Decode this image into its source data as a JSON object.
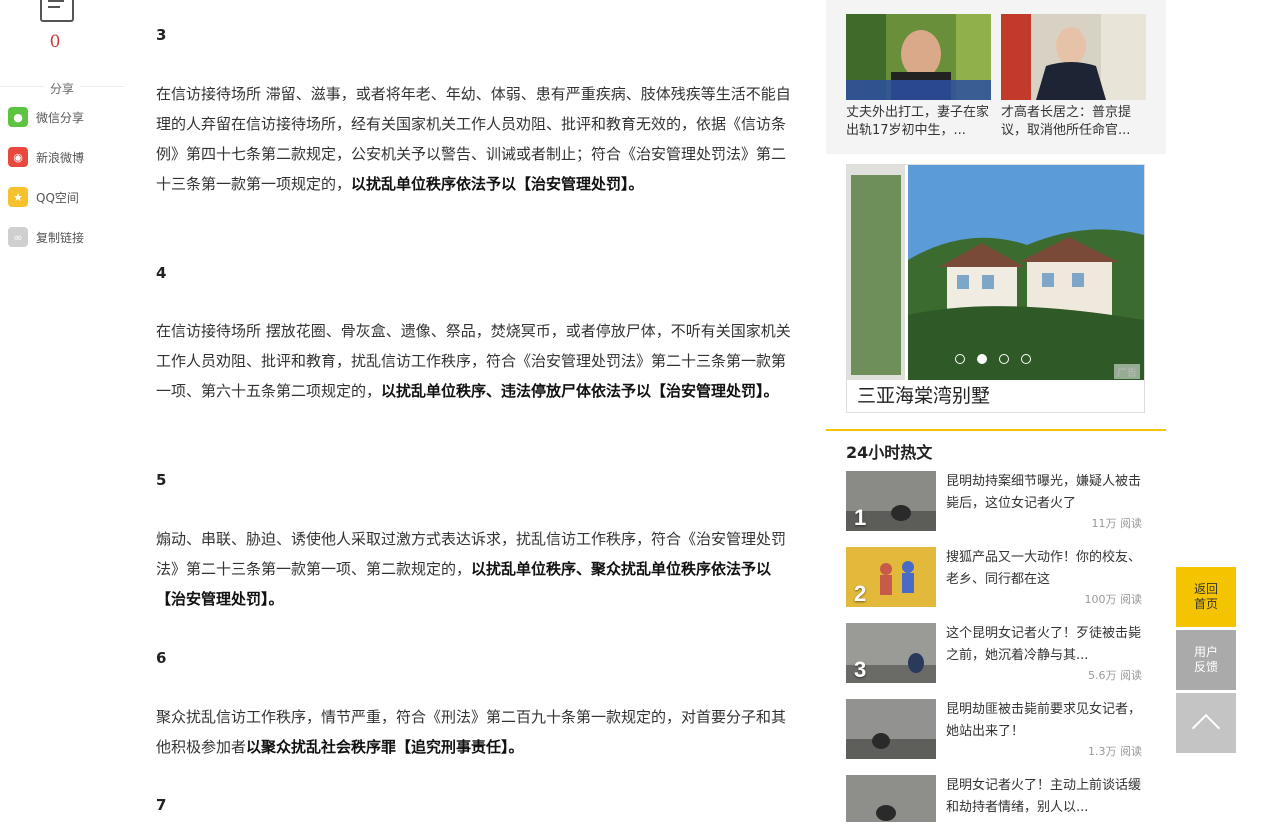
{
  "comments": {
    "count": "0"
  },
  "share": {
    "title": "分享",
    "items": [
      {
        "label": "微信分享",
        "icon": "wechat-icon",
        "color": "#5cc440"
      },
      {
        "label": "新浪微博",
        "icon": "weibo-icon",
        "color": "#e8483e"
      },
      {
        "label": "QQ空间",
        "icon": "qzone-icon",
        "color": "#f6c12c"
      },
      {
        "label": "复制链接",
        "icon": "link-icon",
        "color": "#cfcfcf"
      }
    ]
  },
  "article": {
    "sections": [
      {
        "num": "3",
        "text": "在信访接待场所 滞留、滋事，或者将年老、年幼、体弱、患有严重疾病、肢体残疾等生活不能自理的人弃留在信访接待场所，经有关国家机关工作人员劝阻、批评和教育无效的，依据《信访条例》第四十七条第二款规定，公安机关予以警告、训诫或者制止；符合《治安管理处罚法》第二十三条第一款第一项规定的，",
        "bold": "以扰乱单位秩序依法予以【治安管理处罚】。"
      },
      {
        "num": "4",
        "text": "在信访接待场所 摆放花圈、骨灰盒、遗像、祭品，焚烧冥币，或者停放尸体，不听有关国家机关工作人员劝阻、批评和教育，扰乱信访工作秩序，符合《治安管理处罚法》第二十三条第一款第一项、第六十五条第二项规定的，",
        "bold": "以扰乱单位秩序、违法停放尸体依法予以【治安管理处罚】。"
      },
      {
        "num": "5",
        "text": "煽动、串联、胁迫、诱使他人采取过激方式表达诉求，扰乱信访工作秩序，符合《治安管理处罚法》第二十三条第一款第一项、第二款规定的，",
        "bold": "以扰乱单位秩序、聚众扰乱单位秩序依法予以【治安管理处罚】。"
      },
      {
        "num": "6",
        "text": "聚众扰乱信访工作秩序，情节严重，符合《刑法》第二百九十条第一款规定的，对首要分子和其他积极参加者",
        "bold": "以聚众扰乱社会秩序罪【追究刑事责任】。"
      },
      {
        "num": "7",
        "text": "",
        "bold": ""
      }
    ]
  },
  "top_news": [
    {
      "caption": "丈夫外出打工，妻子在家出轨17岁初中生，..."
    },
    {
      "caption": "才高者长居之：普京提议，取消他所任命官..."
    }
  ],
  "ad": {
    "title": "三亚海棠湾别墅",
    "tag": "广告"
  },
  "hot": {
    "title": "24小时热文",
    "items": [
      {
        "rank": "1",
        "title": "昆明劫持案细节曝光，嫌疑人被击毙后，这位女记者火了",
        "reads": "11万 阅读"
      },
      {
        "rank": "2",
        "title": "搜狐产品又一大动作！你的校友、老乡、同行都在这",
        "reads": "100万 阅读"
      },
      {
        "rank": "3",
        "title": "这个昆明女记者火了！歹徒被击毙之前，她沉着冷静与其...",
        "reads": "5.6万 阅读"
      },
      {
        "rank": "",
        "title": "昆明劫匪被击毙前要求见女记者，她站出来了！",
        "reads": "1.3万 阅读"
      },
      {
        "rank": "",
        "title": "昆明女记者火了！主动上前谈话缓和劫持者情绪，别人以...",
        "reads": ""
      }
    ]
  },
  "float": {
    "home": "返回首页",
    "feedback": "用户反馈"
  }
}
